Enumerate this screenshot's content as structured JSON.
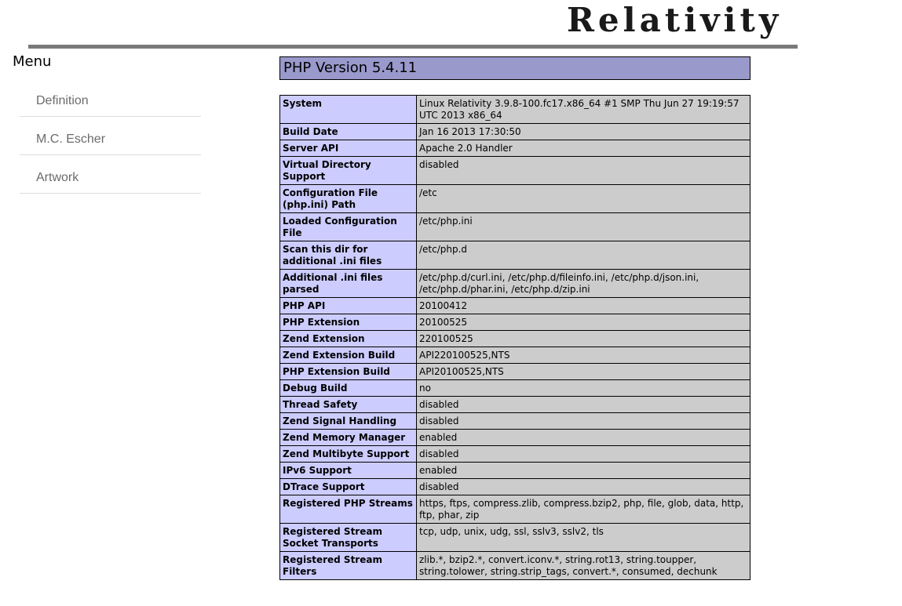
{
  "header": {
    "logo_text": "Relativity"
  },
  "menu": {
    "title": "Menu",
    "items": [
      {
        "label": "Definition"
      },
      {
        "label": "M.C. Escher"
      },
      {
        "label": "Artwork"
      }
    ]
  },
  "phpinfo": {
    "version_title": "PHP Version 5.4.11",
    "rows": [
      {
        "key": "System",
        "value": "Linux Relativity 3.9.8-100.fc17.x86_64 #1 SMP Thu Jun 27 19:19:57 UTC 2013 x86_64"
      },
      {
        "key": "Build Date",
        "value": "Jan 16 2013 17:30:50"
      },
      {
        "key": "Server API",
        "value": "Apache 2.0 Handler"
      },
      {
        "key": "Virtual Directory Support",
        "value": "disabled"
      },
      {
        "key": "Configuration File (php.ini) Path",
        "value": "/etc"
      },
      {
        "key": "Loaded Configuration File",
        "value": "/etc/php.ini"
      },
      {
        "key": "Scan this dir for additional .ini files",
        "value": "/etc/php.d"
      },
      {
        "key": "Additional .ini files parsed",
        "value": "/etc/php.d/curl.ini, /etc/php.d/fileinfo.ini, /etc/php.d/json.ini, /etc/php.d/phar.ini, /etc/php.d/zip.ini"
      },
      {
        "key": "PHP API",
        "value": "20100412"
      },
      {
        "key": "PHP Extension",
        "value": "20100525"
      },
      {
        "key": "Zend Extension",
        "value": "220100525"
      },
      {
        "key": "Zend Extension Build",
        "value": "API220100525,NTS"
      },
      {
        "key": "PHP Extension Build",
        "value": "API20100525,NTS"
      },
      {
        "key": "Debug Build",
        "value": "no"
      },
      {
        "key": "Thread Safety",
        "value": "disabled"
      },
      {
        "key": "Zend Signal Handling",
        "value": "disabled"
      },
      {
        "key": "Zend Memory Manager",
        "value": "enabled"
      },
      {
        "key": "Zend Multibyte Support",
        "value": "disabled"
      },
      {
        "key": "IPv6 Support",
        "value": "enabled"
      },
      {
        "key": "DTrace Support",
        "value": "disabled"
      },
      {
        "key": "Registered PHP Streams",
        "value": "https, ftps, compress.zlib, compress.bzip2, php, file, glob, data, http, ftp, phar, zip"
      },
      {
        "key": "Registered Stream Socket Transports",
        "value": "tcp, udp, unix, udg, ssl, sslv3, sslv2, tls"
      },
      {
        "key": "Registered Stream Filters",
        "value": "zlib.*, bzip2.*, convert.iconv.*, string.rot13, string.toupper, string.tolower, string.strip_tags, convert.*, consumed, dechunk"
      }
    ]
  },
  "colors": {
    "header_bar": "#9999cc",
    "key_cell": "#ccccff",
    "value_cell": "#cccccc",
    "rule": "#7a7a7a"
  }
}
